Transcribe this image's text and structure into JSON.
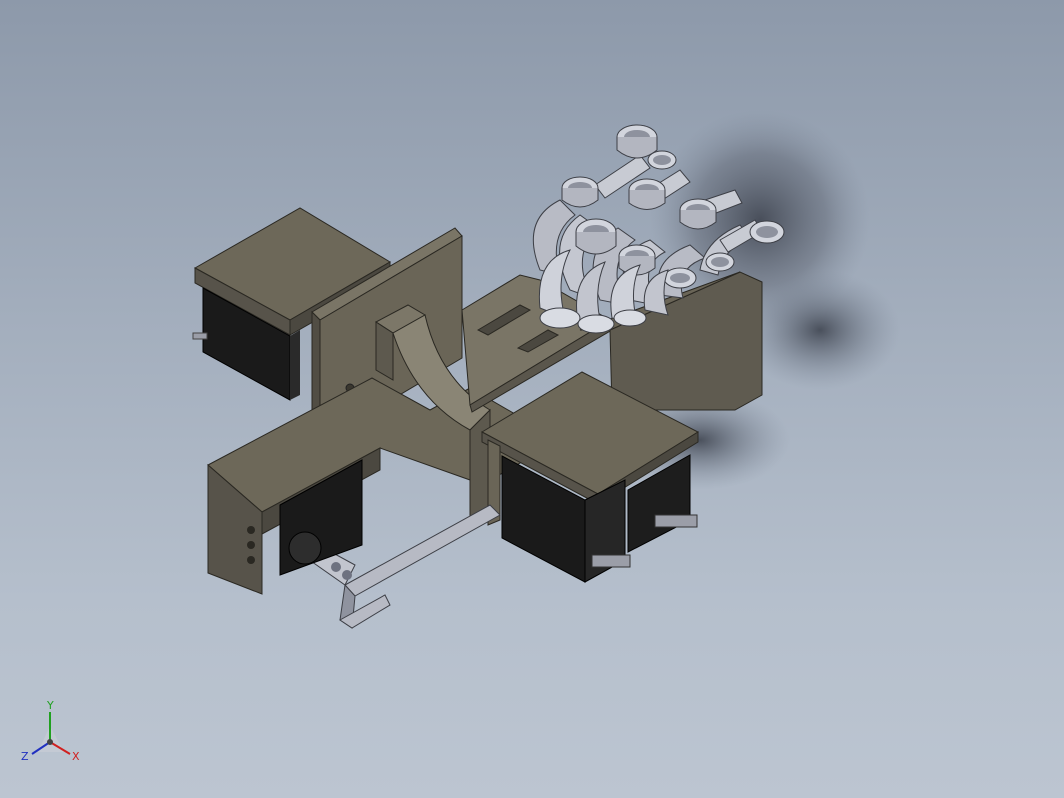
{
  "app": {
    "name": "3D CAD viewport",
    "view": "isometric"
  },
  "model": {
    "description_visible": false
  },
  "triad": {
    "x_label": "X",
    "y_label": "Y",
    "z_label": "Z",
    "x_color": "#d02020",
    "y_color": "#20a020",
    "z_color": "#2030c0"
  },
  "colors": {
    "background_top": "#8d99aa",
    "background_bottom": "#bcc5d1",
    "body_top": "#6b6658",
    "body_side": "#57534a",
    "body_dark": "#45423b",
    "servo_black": "#1b1b1b",
    "finger_light": "#c7cad3",
    "finger_shade": "#9da1ad"
  }
}
